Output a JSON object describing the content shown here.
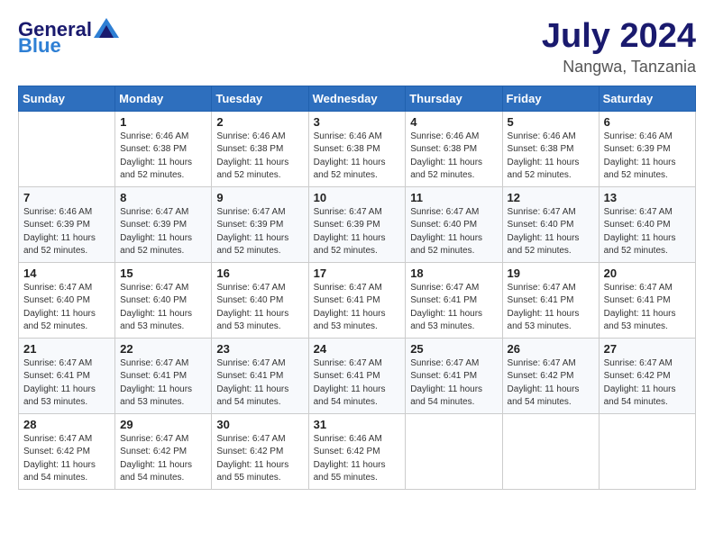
{
  "header": {
    "logo_general": "General",
    "logo_blue": "Blue",
    "month": "July 2024",
    "location": "Nangwa, Tanzania"
  },
  "weekdays": [
    "Sunday",
    "Monday",
    "Tuesday",
    "Wednesday",
    "Thursday",
    "Friday",
    "Saturday"
  ],
  "weeks": [
    [
      {
        "day": "",
        "detail": ""
      },
      {
        "day": "1",
        "detail": "Sunrise: 6:46 AM\nSunset: 6:38 PM\nDaylight: 11 hours\nand 52 minutes."
      },
      {
        "day": "2",
        "detail": "Sunrise: 6:46 AM\nSunset: 6:38 PM\nDaylight: 11 hours\nand 52 minutes."
      },
      {
        "day": "3",
        "detail": "Sunrise: 6:46 AM\nSunset: 6:38 PM\nDaylight: 11 hours\nand 52 minutes."
      },
      {
        "day": "4",
        "detail": "Sunrise: 6:46 AM\nSunset: 6:38 PM\nDaylight: 11 hours\nand 52 minutes."
      },
      {
        "day": "5",
        "detail": "Sunrise: 6:46 AM\nSunset: 6:38 PM\nDaylight: 11 hours\nand 52 minutes."
      },
      {
        "day": "6",
        "detail": "Sunrise: 6:46 AM\nSunset: 6:39 PM\nDaylight: 11 hours\nand 52 minutes."
      }
    ],
    [
      {
        "day": "7",
        "detail": "Sunrise: 6:46 AM\nSunset: 6:39 PM\nDaylight: 11 hours\nand 52 minutes."
      },
      {
        "day": "8",
        "detail": "Sunrise: 6:47 AM\nSunset: 6:39 PM\nDaylight: 11 hours\nand 52 minutes."
      },
      {
        "day": "9",
        "detail": "Sunrise: 6:47 AM\nSunset: 6:39 PM\nDaylight: 11 hours\nand 52 minutes."
      },
      {
        "day": "10",
        "detail": "Sunrise: 6:47 AM\nSunset: 6:39 PM\nDaylight: 11 hours\nand 52 minutes."
      },
      {
        "day": "11",
        "detail": "Sunrise: 6:47 AM\nSunset: 6:40 PM\nDaylight: 11 hours\nand 52 minutes."
      },
      {
        "day": "12",
        "detail": "Sunrise: 6:47 AM\nSunset: 6:40 PM\nDaylight: 11 hours\nand 52 minutes."
      },
      {
        "day": "13",
        "detail": "Sunrise: 6:47 AM\nSunset: 6:40 PM\nDaylight: 11 hours\nand 52 minutes."
      }
    ],
    [
      {
        "day": "14",
        "detail": "Sunrise: 6:47 AM\nSunset: 6:40 PM\nDaylight: 11 hours\nand 52 minutes."
      },
      {
        "day": "15",
        "detail": "Sunrise: 6:47 AM\nSunset: 6:40 PM\nDaylight: 11 hours\nand 53 minutes."
      },
      {
        "day": "16",
        "detail": "Sunrise: 6:47 AM\nSunset: 6:40 PM\nDaylight: 11 hours\nand 53 minutes."
      },
      {
        "day": "17",
        "detail": "Sunrise: 6:47 AM\nSunset: 6:41 PM\nDaylight: 11 hours\nand 53 minutes."
      },
      {
        "day": "18",
        "detail": "Sunrise: 6:47 AM\nSunset: 6:41 PM\nDaylight: 11 hours\nand 53 minutes."
      },
      {
        "day": "19",
        "detail": "Sunrise: 6:47 AM\nSunset: 6:41 PM\nDaylight: 11 hours\nand 53 minutes."
      },
      {
        "day": "20",
        "detail": "Sunrise: 6:47 AM\nSunset: 6:41 PM\nDaylight: 11 hours\nand 53 minutes."
      }
    ],
    [
      {
        "day": "21",
        "detail": "Sunrise: 6:47 AM\nSunset: 6:41 PM\nDaylight: 11 hours\nand 53 minutes."
      },
      {
        "day": "22",
        "detail": "Sunrise: 6:47 AM\nSunset: 6:41 PM\nDaylight: 11 hours\nand 53 minutes."
      },
      {
        "day": "23",
        "detail": "Sunrise: 6:47 AM\nSunset: 6:41 PM\nDaylight: 11 hours\nand 54 minutes."
      },
      {
        "day": "24",
        "detail": "Sunrise: 6:47 AM\nSunset: 6:41 PM\nDaylight: 11 hours\nand 54 minutes."
      },
      {
        "day": "25",
        "detail": "Sunrise: 6:47 AM\nSunset: 6:41 PM\nDaylight: 11 hours\nand 54 minutes."
      },
      {
        "day": "26",
        "detail": "Sunrise: 6:47 AM\nSunset: 6:42 PM\nDaylight: 11 hours\nand 54 minutes."
      },
      {
        "day": "27",
        "detail": "Sunrise: 6:47 AM\nSunset: 6:42 PM\nDaylight: 11 hours\nand 54 minutes."
      }
    ],
    [
      {
        "day": "28",
        "detail": "Sunrise: 6:47 AM\nSunset: 6:42 PM\nDaylight: 11 hours\nand 54 minutes."
      },
      {
        "day": "29",
        "detail": "Sunrise: 6:47 AM\nSunset: 6:42 PM\nDaylight: 11 hours\nand 54 minutes."
      },
      {
        "day": "30",
        "detail": "Sunrise: 6:47 AM\nSunset: 6:42 PM\nDaylight: 11 hours\nand 55 minutes."
      },
      {
        "day": "31",
        "detail": "Sunrise: 6:46 AM\nSunset: 6:42 PM\nDaylight: 11 hours\nand 55 minutes."
      },
      {
        "day": "",
        "detail": ""
      },
      {
        "day": "",
        "detail": ""
      },
      {
        "day": "",
        "detail": ""
      }
    ]
  ]
}
